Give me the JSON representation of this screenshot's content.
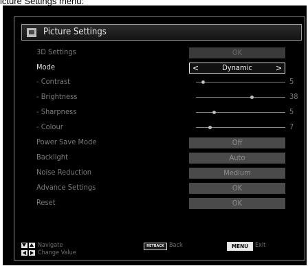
{
  "caption": "icture Settings menu:",
  "title": "Picture Settings",
  "rows": {
    "settings_3d": {
      "label": "3D Settings",
      "value": "OK"
    },
    "mode": {
      "label": "Mode",
      "value": "Dynamic"
    },
    "contrast": {
      "label": "- Contrast",
      "value": "5"
    },
    "brightness": {
      "label": "- Brightness",
      "value": "38"
    },
    "sharpness": {
      "label": "- Sharpness",
      "value": "5"
    },
    "colour": {
      "label": "- Colour",
      "value": "7"
    },
    "power_save": {
      "label": "Power Save Mode",
      "value": "Off"
    },
    "backlight": {
      "label": "Backlight",
      "value": "Auto"
    },
    "noise": {
      "label": "Noise Reduction",
      "value": "Medium"
    },
    "advance": {
      "label": "Advance Settings",
      "value": "OK"
    },
    "reset": {
      "label": "Reset",
      "value": "OK"
    }
  },
  "sliders": {
    "contrast": 0.08,
    "brightness": 0.62,
    "sharpness": 0.2,
    "colour": 0.15
  },
  "footer": {
    "navigate": "Navigate",
    "change_value": "Change Value",
    "retback_key": "RETBACK",
    "back": "Back",
    "menu_key": "MENU",
    "exit": "Exit"
  }
}
